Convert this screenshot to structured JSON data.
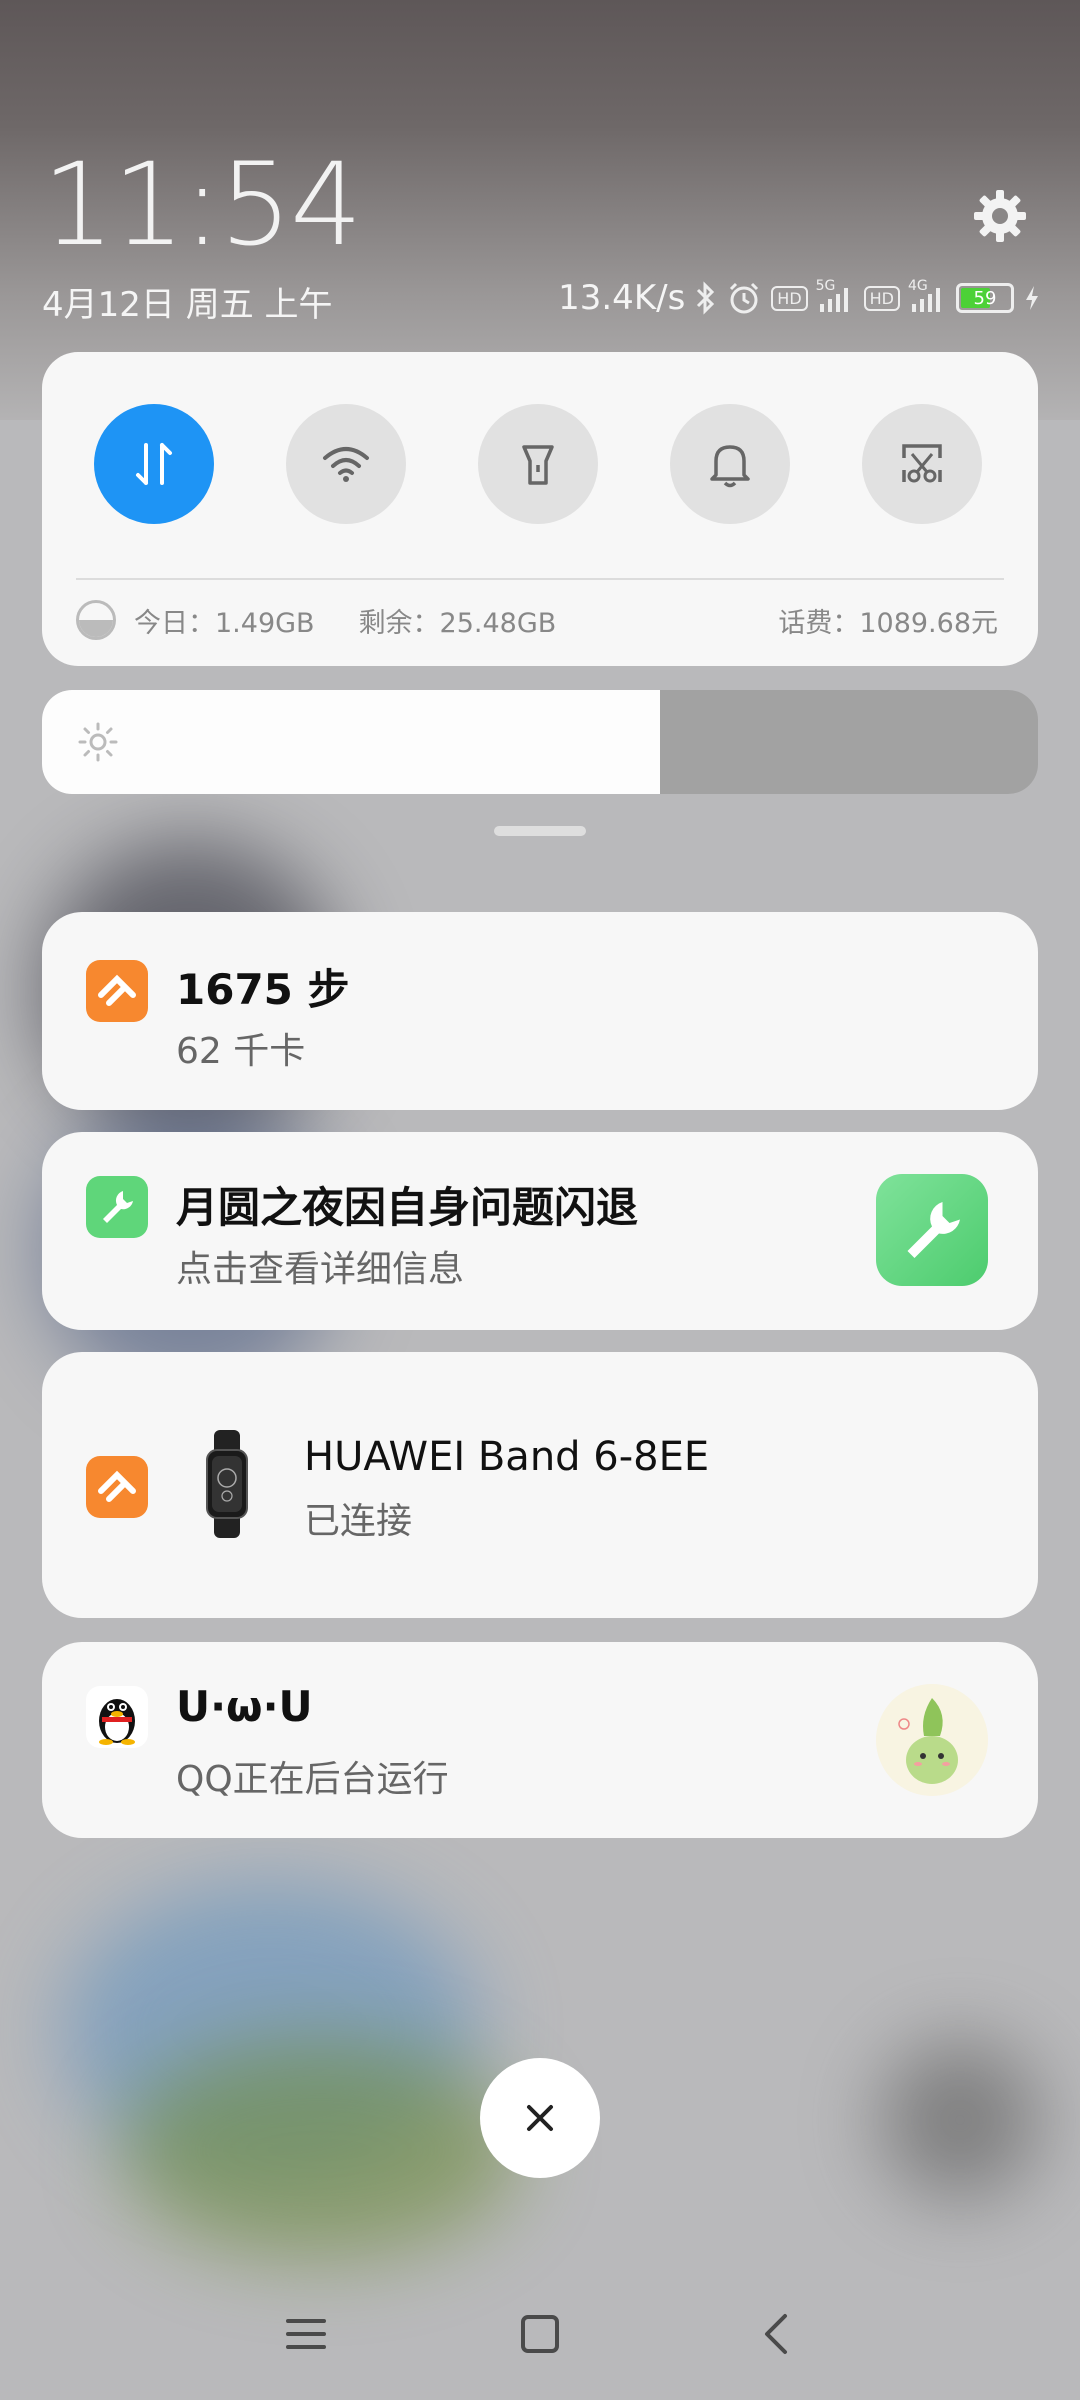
{
  "status": {
    "time": "11:54",
    "date": "4月12日 周五 上午",
    "net_speed": "13.4K/s",
    "sim1_type": "5G",
    "sim2_type": "4G",
    "hd_label": "HD",
    "battery": "59",
    "icons": [
      "bluetooth-icon",
      "alarm-icon",
      "signal-icon",
      "charging-icon"
    ]
  },
  "quick_settings": {
    "toggles": [
      "mobile-data",
      "wifi",
      "flashlight",
      "ringer",
      "screenshot"
    ],
    "today_label": "今日：1.49GB",
    "remaining_label": "剩余：25.48GB",
    "balance_label": "话费：1089.68元"
  },
  "brightness": {
    "level": 0.62
  },
  "notifications": [
    {
      "title": "1675 步",
      "subtitle": "62 千卡",
      "app": "huawei-health"
    },
    {
      "title": "月圆之夜因自身问题闪退",
      "subtitle": "点击查看详细信息",
      "app": "repair-tool"
    },
    {
      "title": "HUAWEI Band 6-8EE",
      "subtitle": "已连接",
      "app": "huawei-health"
    },
    {
      "title": "U·ω·U",
      "subtitle": "QQ正在后台运行",
      "app": "qq"
    }
  ],
  "colors": {
    "accent": "#1e94f5",
    "health": "#f7882f",
    "repair": "#5fd67a",
    "battery_fill": "#4cd137"
  }
}
